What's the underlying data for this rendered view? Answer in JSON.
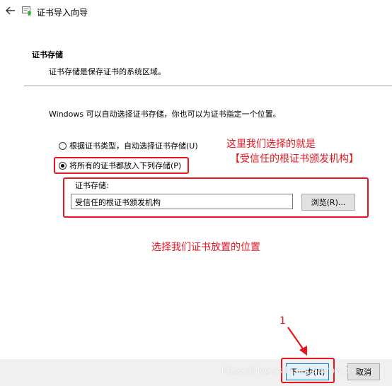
{
  "window": {
    "title": "证书导入向导",
    "back_icon": "arrow-left-icon",
    "app_icon": "certificate-wizard-icon"
  },
  "header": {
    "section_title": "证书存储",
    "section_desc": "证书存储是保存证书的系统区域。"
  },
  "body": {
    "intro": "Windows 可以自动选择证书存储，你也可以为证书指定一个位置。",
    "options": [
      {
        "label": "根据证书类型，自动选择证书存储(U)",
        "checked": false
      },
      {
        "label": "将所有的证书都放入下列存储(P)",
        "checked": true
      }
    ],
    "store_label": "证书存储:",
    "store_value": "受信任的根证书颁发机构",
    "browse_label": "浏览(R)..."
  },
  "annotations": {
    "note_line1": "这里我们选择的就是",
    "note_line2": "【受信任的根证书颁发机构】",
    "note_location": "选择我们证书放置的位置",
    "step_number": "1",
    "color": "#e8141f"
  },
  "footer": {
    "next_label": "下一步(N)",
    "cancel_label": "取消",
    "watermark": "https://blog.csdn.net/Sorrow_ok"
  },
  "colors": {
    "accent_border": "#0078d7",
    "button_bg": "#e1e1e1",
    "bottom_bar_bg": "#f0f0f0",
    "annotation_red": "#e8141f"
  }
}
